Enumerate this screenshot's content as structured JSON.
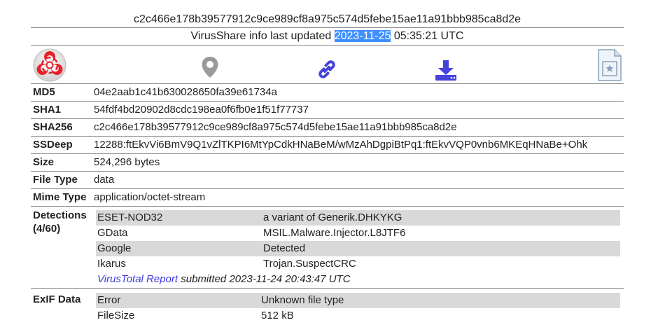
{
  "header": {
    "sha256_title": "c2c466e178b39577912c9ce989cf8a975c574d5febe15ae11a91bbb985ca8d2e",
    "updated_prefix": "VirusShare info last updated ",
    "updated_date": "2023-11-25",
    "updated_time": " 05:35:21 UTC"
  },
  "icons": [
    "biohazard-icon",
    "location-pin-icon",
    "link-icon",
    "download-icon",
    "document-icon"
  ],
  "colors": {
    "biohazard": "#e8202a",
    "pin": "#999999",
    "link_download": "#4444dd",
    "row_shade": "#d9d9d9",
    "highlight": "#3f8fff"
  },
  "info": {
    "md5": {
      "label": "MD5",
      "value": "04e2aab1c41b630028650fa39e61734a"
    },
    "sha1": {
      "label": "SHA1",
      "value": "54fdf4bd20902d8cdc198ea0f6fb0e1f51f77737"
    },
    "sha256": {
      "label": "SHA256",
      "value": "c2c466e178b39577912c9ce989cf8a975c574d5febe15ae11a91bbb985ca8d2e"
    },
    "ssdeep": {
      "label": "SSDeep",
      "value": "12288:ftEkvVi6BmV9Q1vZlTKPI6MtYpCdkHNaBeM/wMzAhDgpiBtPq1:ftEkvVQP0vnb6MKEqHNaBe+Ohk"
    },
    "size": {
      "label": "Size",
      "value": "524,296 bytes"
    },
    "filetype": {
      "label": "File Type",
      "value": "data"
    },
    "mimetype": {
      "label": "Mime Type",
      "value": "application/octet-stream"
    }
  },
  "detections": {
    "label": "Detections",
    "count": "(4/60)",
    "rows": [
      {
        "engine": "ESET-NOD32",
        "result": "a variant of Generik.DHKYKG"
      },
      {
        "engine": "GData",
        "result": "MSIL.Malware.Injector.L8JTF6"
      },
      {
        "engine": "Google",
        "result": "Detected"
      },
      {
        "engine": "Ikarus",
        "result": "Trojan.SuspectCRC"
      }
    ],
    "vt_link": "VirusTotal Report",
    "vt_submitted": " submitted 2023-11-24 20:43:47 UTC"
  },
  "exif": {
    "label": "ExIF Data",
    "rows": [
      {
        "key": "Error",
        "value": "Unknown file type"
      },
      {
        "key": "FileSize",
        "value": "512 kB"
      }
    ]
  }
}
